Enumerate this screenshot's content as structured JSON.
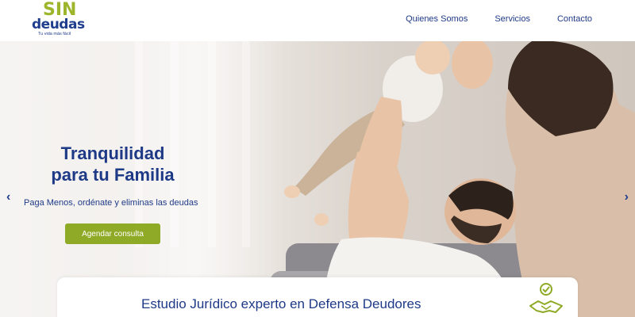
{
  "logo": {
    "top": "SIN",
    "bottom": "deudas",
    "tagline": "Tu vida más fácil"
  },
  "nav": {
    "items": [
      "Quienes Somos",
      "Servicios",
      "Contacto"
    ]
  },
  "hero": {
    "title_line1": "Tranquilidad",
    "title_line2": "para tu Familia",
    "subtitle": "Paga Menos, ordénate y eliminas las deudas",
    "cta_label": "Agendar consulta",
    "prev_arrow": "‹",
    "next_arrow": "›",
    "image": "family-photo"
  },
  "card": {
    "title": "Estudio Jurídico experto en Defensa Deudores",
    "icon": "handshake-check-icon"
  },
  "colors": {
    "primary": "#1e3a87",
    "accent": "#8faa26"
  }
}
